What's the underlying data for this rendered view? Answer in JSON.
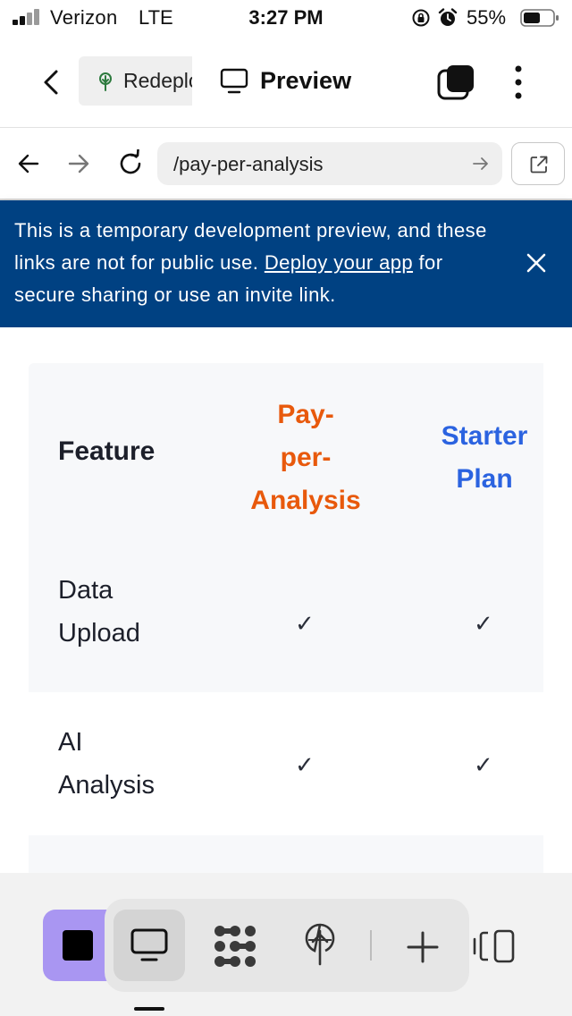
{
  "status_bar": {
    "carrier": "Verizon",
    "network": "LTE",
    "time": "3:27 PM",
    "battery_percent": "55%",
    "icons": [
      "signal-icon",
      "orientation-lock-icon",
      "alarm-icon",
      "battery-icon"
    ]
  },
  "toolbar": {
    "tab_label": "Redeploy",
    "preview_label": "Preview",
    "icons": [
      "back-icon",
      "deploy-tree-icon",
      "monitor-icon",
      "tabs-icon",
      "more-icon"
    ]
  },
  "url_bar": {
    "url": "/pay-per-analysis",
    "icons": [
      "arrow-left-icon",
      "arrow-right-icon",
      "reload-icon",
      "go-arrow-icon",
      "open-external-icon"
    ]
  },
  "banner": {
    "text_before": "This is a temporary development preview, and these links are not for public use. ",
    "link_text": "Deploy your app",
    "text_after": " for secure sharing or use an invite link.",
    "background": "#004182"
  },
  "table": {
    "headers": {
      "feature": "Feature",
      "plan1_lines": [
        "Pay-",
        "per-",
        "Analysis"
      ],
      "plan2_lines": [
        "Starter",
        "Plan"
      ]
    },
    "rows": [
      {
        "feature_lines": [
          "Data",
          "Upload"
        ],
        "plan1": "✓",
        "plan2": "✓"
      },
      {
        "feature_lines": [
          "AI",
          "Analysis"
        ],
        "plan1": "✓",
        "plan2": "✓"
      }
    ],
    "colors": {
      "plan1": "#e8590c",
      "plan2": "#2b63e0"
    }
  },
  "dock": {
    "icons": [
      "console-icon",
      "preview-monitor-icon",
      "workspace-grid-icon",
      "deploy-icon",
      "add-icon",
      "layout-toggle-icon"
    ],
    "accent": "#a996f2"
  }
}
